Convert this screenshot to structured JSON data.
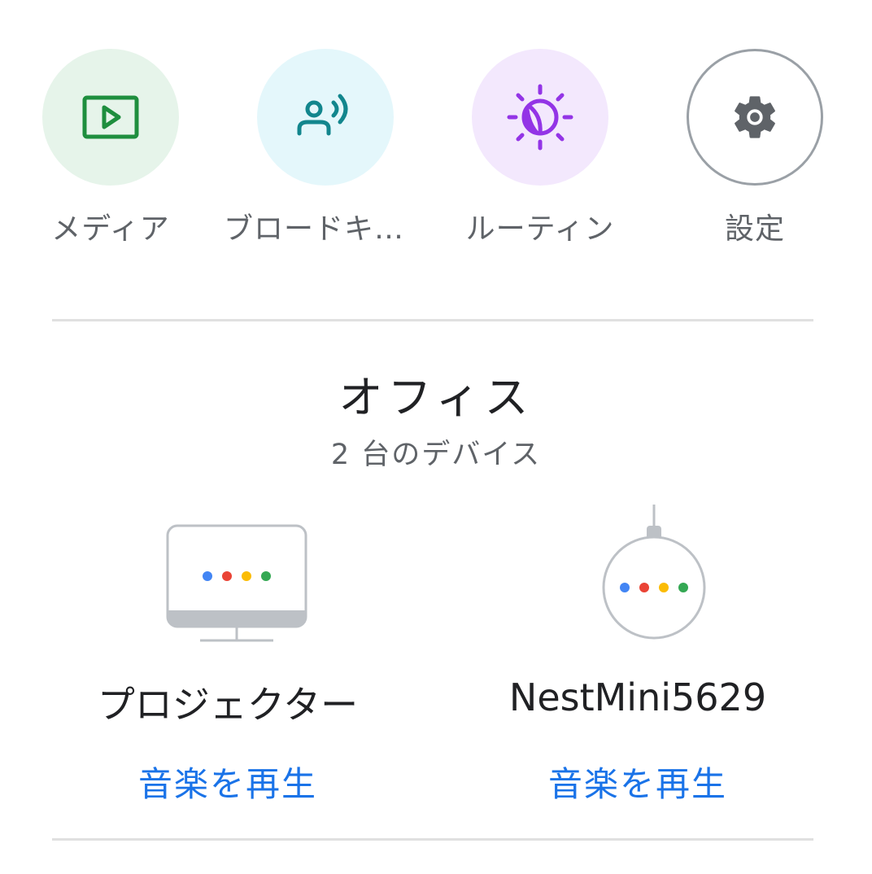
{
  "quick_actions": [
    {
      "label": "メディア",
      "icon": "media-play-icon",
      "bg": "#e6f4ea",
      "color": "#1e8e3e"
    },
    {
      "label": "ブロードキャ...",
      "icon": "broadcast-icon",
      "bg": "#e4f7fb",
      "color": "#12868d"
    },
    {
      "label": "ルーティン",
      "icon": "routine-sun-moon-icon",
      "bg": "#f3e8fd",
      "color": "#9334e6"
    },
    {
      "label": "設定",
      "icon": "gear-icon",
      "bg": "#ffffff",
      "color": "#5f6368"
    }
  ],
  "room": {
    "name": "オフィス",
    "device_count": "2 台のデバイス"
  },
  "devices": [
    {
      "name": "プロジェクター",
      "type": "display",
      "action": "音楽を再生"
    },
    {
      "name": "NestMini5629",
      "type": "speaker",
      "action": "音楽を再生"
    }
  ],
  "colors": {
    "accent": "#1a73e8",
    "dot_blue": "#4285f4",
    "dot_red": "#ea4335",
    "dot_yellow": "#fbbc04",
    "dot_green": "#34a853"
  }
}
